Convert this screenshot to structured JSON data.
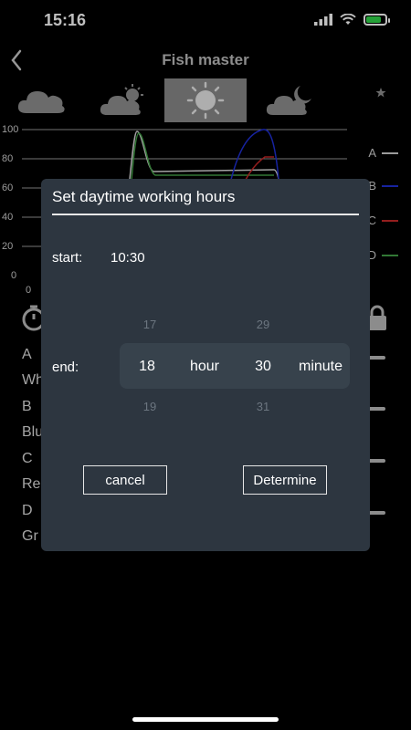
{
  "status": {
    "time": "15:16"
  },
  "header": {
    "title": "Fish master"
  },
  "weather_modes": [
    {
      "icon": "cloudy-icon"
    },
    {
      "icon": "partly-sunny-icon"
    },
    {
      "icon": "sun-icon",
      "selected": true
    },
    {
      "icon": "cloudy-night-icon"
    },
    {
      "icon": "moon-stars-icon"
    }
  ],
  "chart_data": {
    "type": "line",
    "yticks": [
      "100",
      "80",
      "60",
      "40",
      "20",
      "0"
    ],
    "xticks": [
      "0"
    ],
    "ylim": [
      0,
      100
    ],
    "legend": [
      {
        "name": "A",
        "color": "#cfcfcf"
      },
      {
        "name": "B",
        "color": "#1f2fd6"
      },
      {
        "name": "C",
        "color": "#c62828"
      },
      {
        "name": "D",
        "color": "#43a047"
      }
    ]
  },
  "background_list": {
    "rows": [
      {
        "letter": "A",
        "name": "Wh"
      },
      {
        "letter": "B",
        "name": "Blu"
      },
      {
        "letter": "C",
        "name": "Re"
      },
      {
        "letter": "D",
        "name": "Gr"
      }
    ]
  },
  "dialog": {
    "title": "Set daytime working hours",
    "start_label": "start:",
    "start_value": "10:30",
    "end_label": "end:",
    "hour_prev": "17",
    "hour_value": "18",
    "hour_next": "19",
    "hour_unit": "hour",
    "minute_prev": "29",
    "minute_value": "30",
    "minute_next": "31",
    "minute_unit": "minute",
    "cancel_label": "cancel",
    "confirm_label": "Determine"
  }
}
